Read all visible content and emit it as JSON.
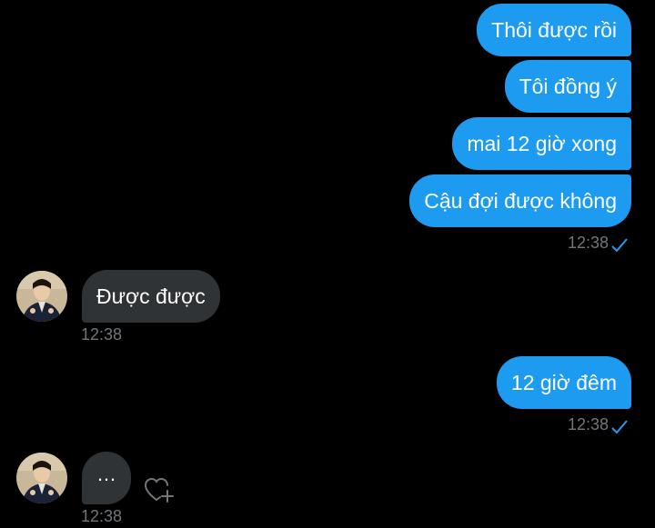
{
  "conversation": {
    "sent_group_1": [
      {
        "text": "Thôi được rồi"
      },
      {
        "text": "Tôi đồng ý"
      },
      {
        "text": "mai 12 giờ xong"
      },
      {
        "text": "Cậu đợi được không"
      }
    ],
    "sent_group_1_time": "12:38",
    "received_1": {
      "text": "Được được",
      "time": "12:38"
    },
    "sent_2": {
      "text": "12 giờ đêm",
      "time": "12:38"
    },
    "typing": {
      "text": "…",
      "time": "12:38"
    }
  },
  "icons": {
    "read_receipt": "checkmark-icon",
    "avatar": "avatar",
    "react": "heart-plus-icon"
  },
  "colors": {
    "background": "#000000",
    "sent_bubble": "#1d9bf0",
    "received_bubble": "#2f3336",
    "timestamp": "#71767b",
    "check": "#1d9bf0"
  }
}
